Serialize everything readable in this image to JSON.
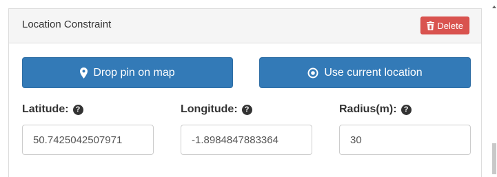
{
  "panel": {
    "title": "Location Constraint",
    "delete_label": "Delete",
    "delete_icon": "trash-icon"
  },
  "buttons": {
    "drop_pin_label": "Drop pin on map",
    "drop_pin_icon": "map-marker-icon",
    "use_current_label": "Use current location",
    "use_current_icon": "target-icon"
  },
  "fields": {
    "latitude": {
      "label": "Latitude:",
      "value": "50.7425042507971"
    },
    "longitude": {
      "label": "Longitude:",
      "value": "-1.8984847883364"
    },
    "radius": {
      "label": "Radius(m):",
      "value": "30"
    }
  },
  "colors": {
    "primary": "#337ab7",
    "danger": "#d9534f",
    "heading_bg": "#f5f5f5"
  }
}
